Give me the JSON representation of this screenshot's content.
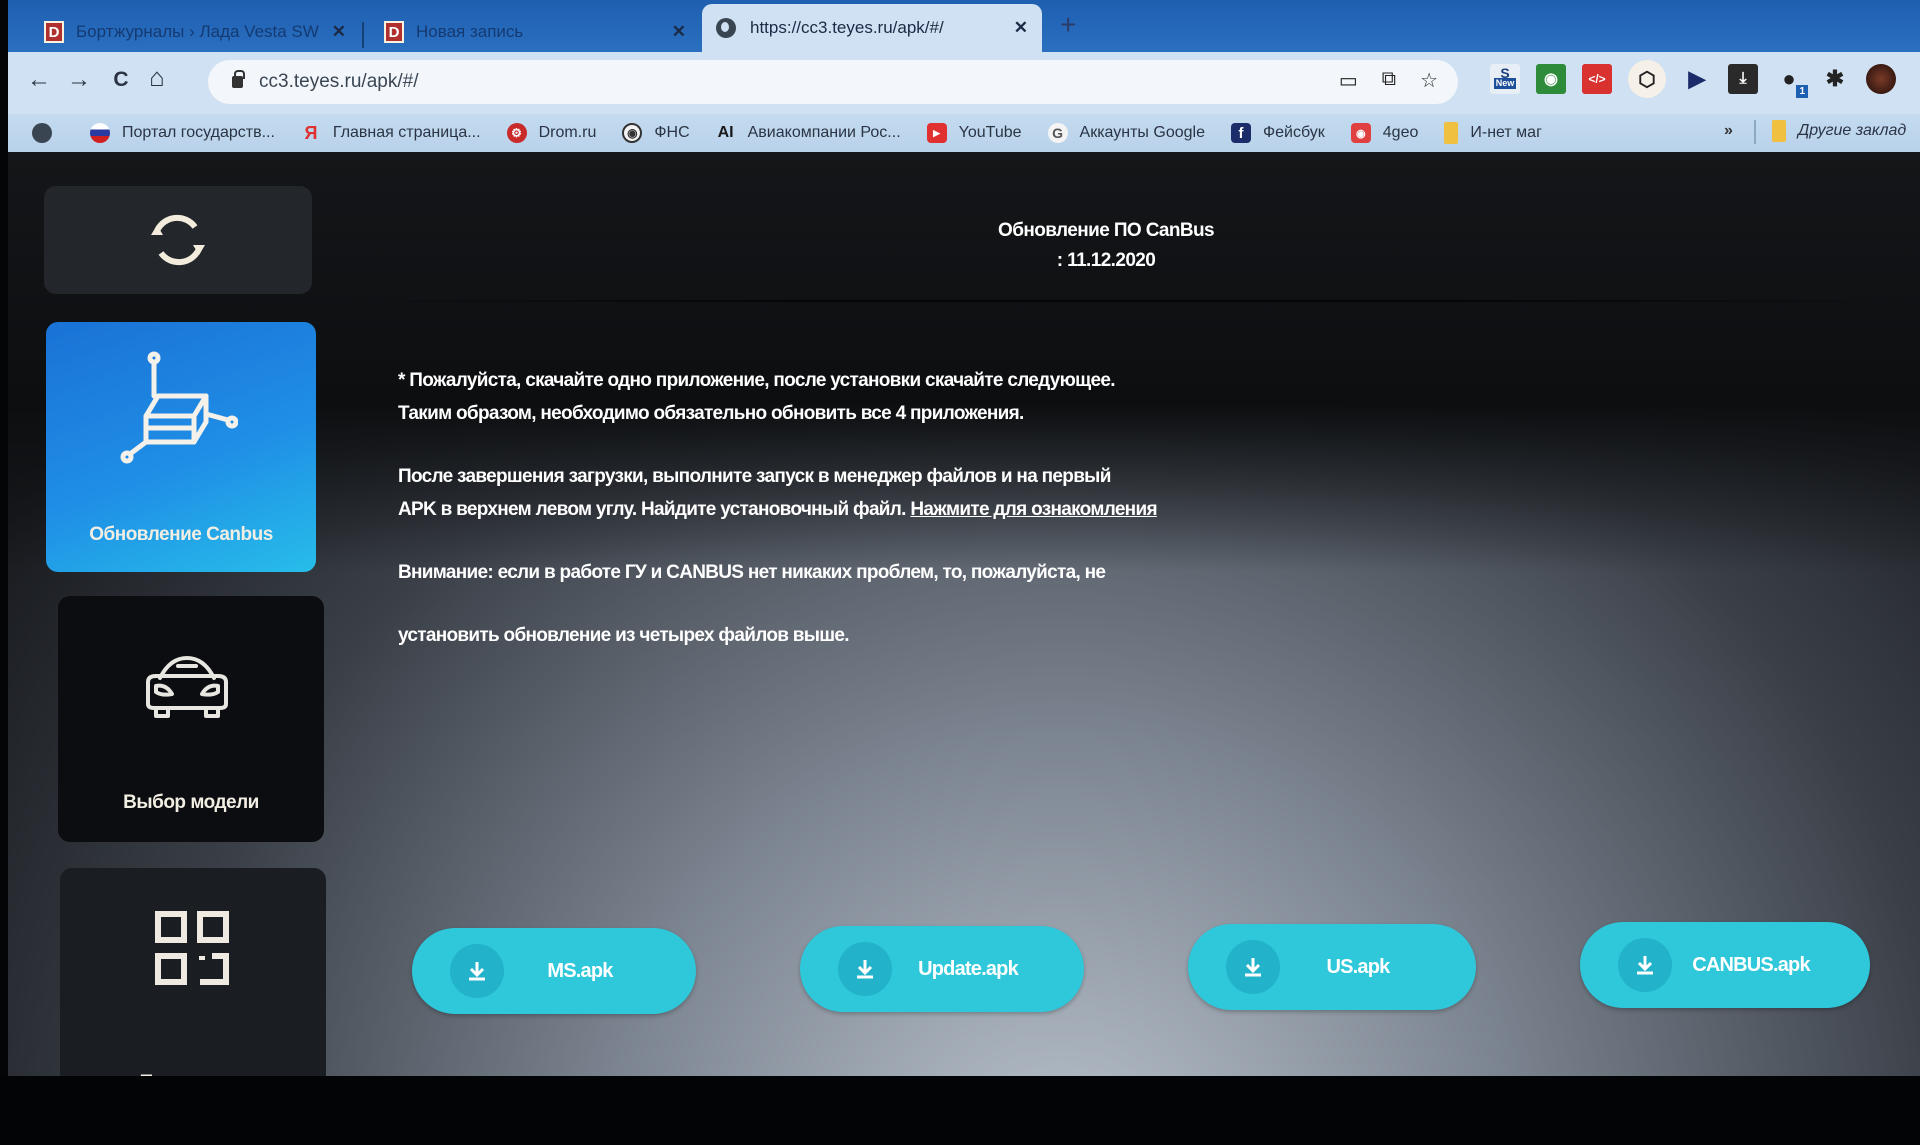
{
  "browser": {
    "tabs": [
      {
        "title": "Бортжурналы › Лада Vesta SW C",
        "favicon": "drive2-d-icon",
        "active": false
      },
      {
        "title": "Новая запись",
        "favicon": "drive2-d-icon",
        "active": false
      },
      {
        "title": "https://cc3.teyes.ru/apk/#/",
        "favicon": "globe-icon",
        "active": true
      }
    ],
    "new_tab_label": "+",
    "url": "cc3.teyes.ru/apk/#/",
    "nav": {
      "back": "←",
      "forward": "→",
      "reload": "C",
      "home": "⌂"
    },
    "omnibox_icons": [
      "cast-icon",
      "translate-icon",
      "star-icon"
    ],
    "extensions": [
      {
        "name": "new-extension-icon",
        "badge": "New"
      },
      {
        "name": "green-pin-extension-icon"
      },
      {
        "name": "red-code-extension-icon",
        "glyph": "</>"
      },
      {
        "name": "cube-extension-icon"
      },
      {
        "name": "play-extension-icon"
      },
      {
        "name": "download-extension-icon"
      },
      {
        "name": "hat-extension-icon",
        "badge": "1"
      },
      {
        "name": "puzzle-extensions-icon"
      },
      {
        "name": "profile-avatar"
      }
    ],
    "bookmarks": [
      {
        "label": "",
        "icon": "globe-icon"
      },
      {
        "label": "Портал государств...",
        "icon": "gosuslugi-icon"
      },
      {
        "label": "Главная страница...",
        "icon": "yandex-icon"
      },
      {
        "label": "Drom.ru",
        "icon": "drom-icon"
      },
      {
        "label": "ФНС",
        "icon": "fns-icon"
      },
      {
        "label": "Авиакомпании Рос...",
        "icon": "a1-icon"
      },
      {
        "label": "YouTube",
        "icon": "youtube-icon"
      },
      {
        "label": "Аккаунты Google",
        "icon": "google-icon"
      },
      {
        "label": "Фейсбук",
        "icon": "facebook-icon"
      },
      {
        "label": "4geo",
        "icon": "4geo-icon"
      },
      {
        "label": "И-нет маг",
        "icon": "folder-icon"
      }
    ],
    "bookmarks_more": "»",
    "other_bookmarks": "Другие заклад"
  },
  "sidebar": {
    "items": [
      {
        "label": "",
        "icon": "refresh-icon"
      },
      {
        "label": "Обновление Canbus",
        "icon": "cube-axes-icon",
        "active": true
      },
      {
        "label": "Выбор модели",
        "icon": "car-icon"
      },
      {
        "label": "Программы",
        "icon": "apps-grid-icon"
      }
    ]
  },
  "header": {
    "title": "Обновление ПО CanBus",
    "date": ": 11.12.2020"
  },
  "notice": {
    "line1": "* Пожалуйста, скачайте одно приложение, после установки скачайте следующее.",
    "line2": "Таким образом, необходимо обязательно обновить все 4 приложения.",
    "line3": "После завершения загрузки, выполните запуск в менеджер файлов и на первый",
    "line4": "APK в верхнем левом углу. Найдите установочный файл.",
    "link": "Нажмите для ознакомления",
    "warning1": "Внимание: если в работе ГУ и CANBUS нет никаких проблем, то, пожалуйста, не",
    "warning2": "установить обновление из четырех файлов выше."
  },
  "downloads": [
    {
      "label": "MS.apk"
    },
    {
      "label": "Update.apk"
    },
    {
      "label": "US.apk"
    },
    {
      "label": "CANBUS.apk"
    }
  ],
  "colors": {
    "accent_blue": "#1f8ee6",
    "download_cyan": "#2ec8da",
    "chrome_tab_blue": "#2a6fc0"
  }
}
